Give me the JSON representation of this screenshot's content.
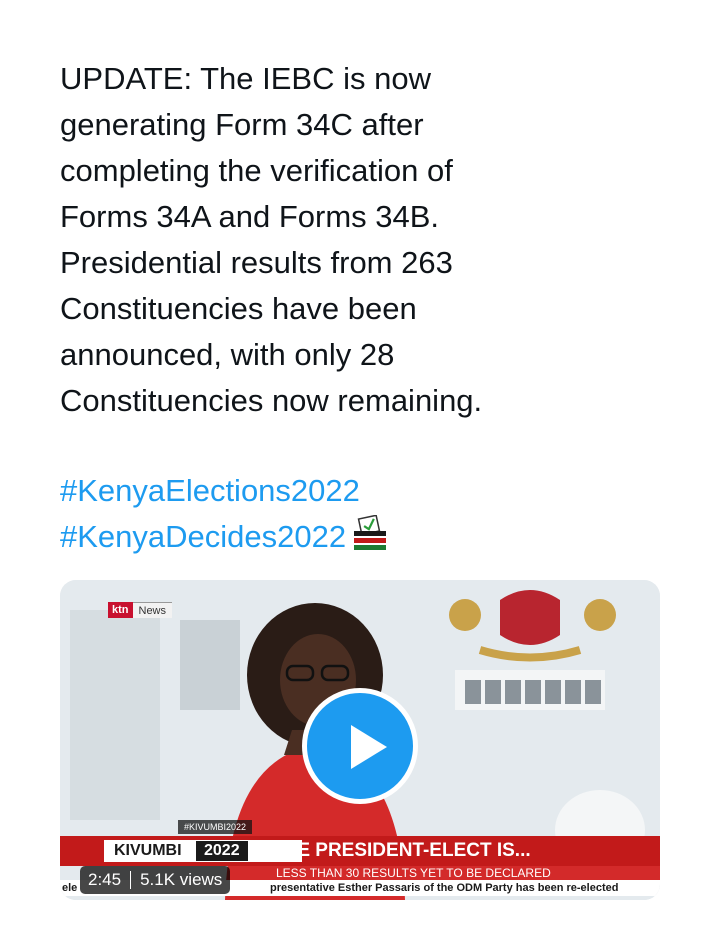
{
  "tweet": {
    "text_lines": [
      "UPDATE: The IEBC is now",
      "generating Form 34C after",
      "completing the verification of",
      "Forms 34A and Forms 34B.",
      "Presidential results from 263",
      "Constituencies have been",
      "announced, with only 28",
      "Constituencies now remaining."
    ],
    "hashtags": [
      "#KenyaElections2022",
      "#KenyaDecides2022"
    ],
    "emoji": "ballot-box-with-kenya-flag",
    "link_color": "#1d9bf0"
  },
  "video": {
    "channel_logo": {
      "ktn": "ktn",
      "news": "News"
    },
    "hashtag_tag": "#KIVUMBI2022",
    "lower_third": {
      "brand": "KIVUMBI",
      "year": "2022",
      "headline": "THE PRESIDENT-ELECT IS...",
      "subheadline": "LESS THAN 30 RESULTS YET TO BE DECLARED",
      "ticker_left": "ele",
      "ticker_right": "presentative Esther Passaris of the ODM Party has been re-elected"
    },
    "duration": "2:45",
    "views": "5.1K views",
    "play_button_color": "#1d9bf0",
    "accent_red": "#c21a1a"
  }
}
